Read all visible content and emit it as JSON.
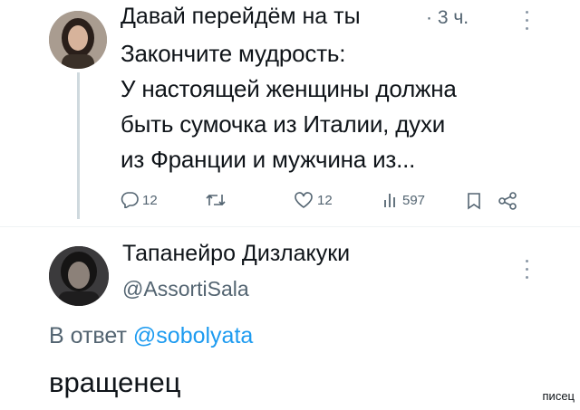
{
  "post": {
    "author_name": "Давай перейдём на ты",
    "time": "· 3 ч.",
    "text": "Закончите мудрость:\nУ настоящей женщины должна\nбыть сумочка из Италии, духи\nиз Франции и мужчина из...",
    "actions": {
      "reply_count": "12",
      "repost_count": "",
      "like_count": "12",
      "views_count": "597"
    }
  },
  "reply": {
    "author_name": "Тапанейро Дизлакуки",
    "handle": "@AssortiSala",
    "reply_to_prefix": "В ответ",
    "reply_to_mention": "@sobolyata",
    "text": "вращенец"
  },
  "watermark": "писец",
  "colors": {
    "text": "#0f1419",
    "muted": "#536471",
    "link": "#1d9bf0",
    "thread_line": "#cfd9de"
  },
  "icons": [
    "more-icon",
    "reply-icon",
    "repost-icon",
    "like-icon",
    "views-icon",
    "bookmark-icon",
    "share-icon"
  ]
}
